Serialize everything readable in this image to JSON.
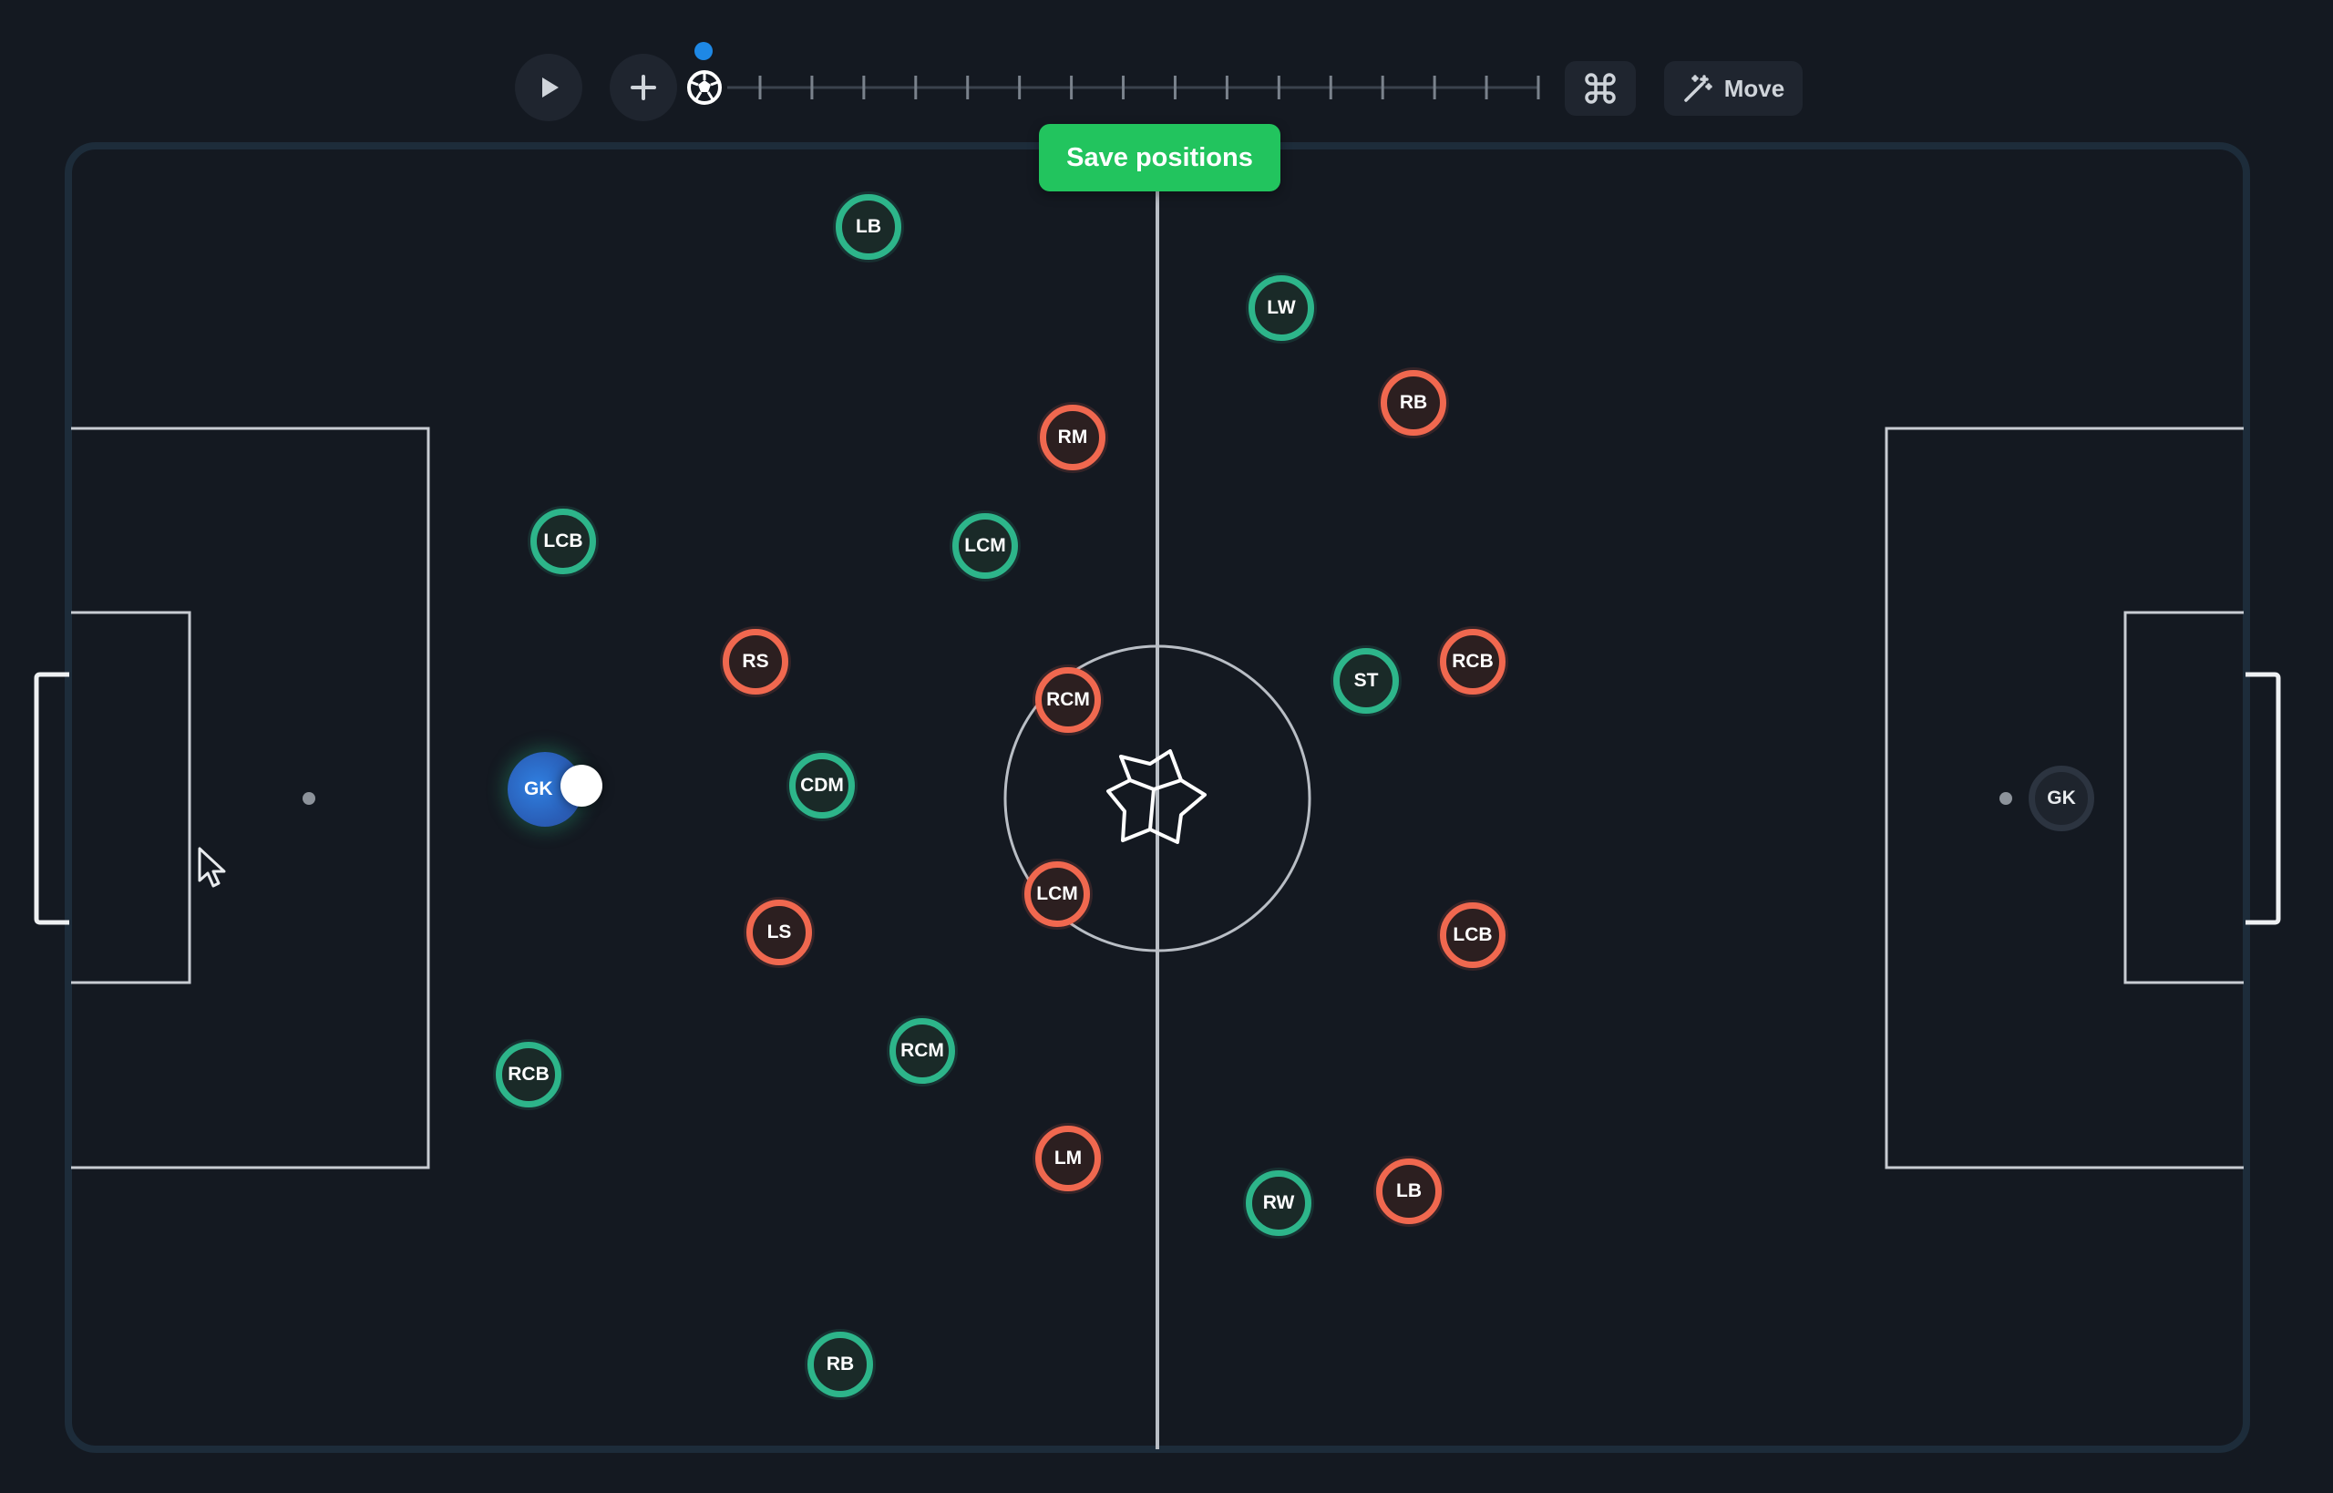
{
  "toolbar": {
    "move_label": "Move",
    "save_label": "Save positions",
    "timeline_ticks": 15,
    "icons": [
      "play-icon",
      "plus-icon",
      "soccer-ball-icon",
      "command-icon",
      "magic-wand-icon"
    ]
  },
  "colors": {
    "background": "#141921",
    "pitch_line": "#c8ccd2",
    "home_team": "#2db58a",
    "away_team": "#f0684f",
    "save_button": "#22c45e",
    "timeline_marker": "#1e88e5",
    "selected_player": "#2f7fe0"
  },
  "home_players": [
    {
      "label": "LB"
    },
    {
      "label": "LW"
    },
    {
      "label": "LCB"
    },
    {
      "label": "LCM"
    },
    {
      "label": "ST"
    },
    {
      "label": "GK"
    },
    {
      "label": "CDM"
    },
    {
      "label": "RCB"
    },
    {
      "label": "RCM"
    },
    {
      "label": "RW"
    },
    {
      "label": "RB"
    }
  ],
  "away_players": [
    {
      "label": "RB"
    },
    {
      "label": "RM"
    },
    {
      "label": "RS"
    },
    {
      "label": "RCM"
    },
    {
      "label": "RCB"
    },
    {
      "label": "LCM"
    },
    {
      "label": "LS"
    },
    {
      "label": "LCB"
    },
    {
      "label": "LM"
    },
    {
      "label": "LB"
    }
  ],
  "other_players": [
    {
      "label": "GK"
    }
  ]
}
